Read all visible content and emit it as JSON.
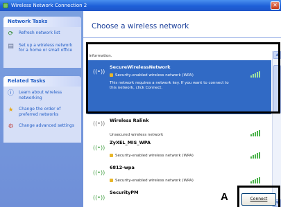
{
  "window": {
    "title": "Wireless Network Connection 2",
    "close_glyph": "✕"
  },
  "sidebar": {
    "network_tasks": {
      "header": "Network Tasks",
      "items": [
        {
          "label": "Refresh network list",
          "icon": "refresh-icon"
        },
        {
          "label": "Set up a wireless network for a home or small office",
          "icon": "setup-network-icon"
        }
      ]
    },
    "related_tasks": {
      "header": "Related Tasks",
      "items": [
        {
          "label": "Learn about wireless networking",
          "icon": "info-icon"
        },
        {
          "label": "Change the order of preferred networks",
          "icon": "star-icon"
        },
        {
          "label": "Change advanced settings",
          "icon": "settings-icon"
        }
      ]
    }
  },
  "main": {
    "title": "Choose a wireless network",
    "list_header": "information.",
    "networks": [
      {
        "name": "SecureWirelessNetwork",
        "security": "Security-enabled wireless network (WPA)",
        "description": "This network requires a network key. If you want to connect to this network, click Connect.",
        "selected": true,
        "signal_bars": 5
      },
      {
        "name": "Wireless Ralink",
        "security": "Unsecured wireless network",
        "selected": false,
        "signal_bars": 5
      },
      {
        "name": "ZyXEL_MIS_WPA",
        "security": "Security-enabled wireless network (WPA)",
        "selected": false,
        "signal_bars": 5
      },
      {
        "name": "6812-wpa",
        "security": "Security-enabled wireless network (WPA)",
        "selected": false,
        "signal_bars": 5
      },
      {
        "name": "SecurityPM",
        "security": "",
        "selected": false,
        "signal_bars": 0
      }
    ],
    "connect_button": "Connect"
  },
  "annotation": {
    "callout_label": "A"
  },
  "colors": {
    "titlebar": "#1d5fd8",
    "sidebar": "#6f8fd8",
    "selection": "#316ac5",
    "signal": "#4bb34b"
  }
}
